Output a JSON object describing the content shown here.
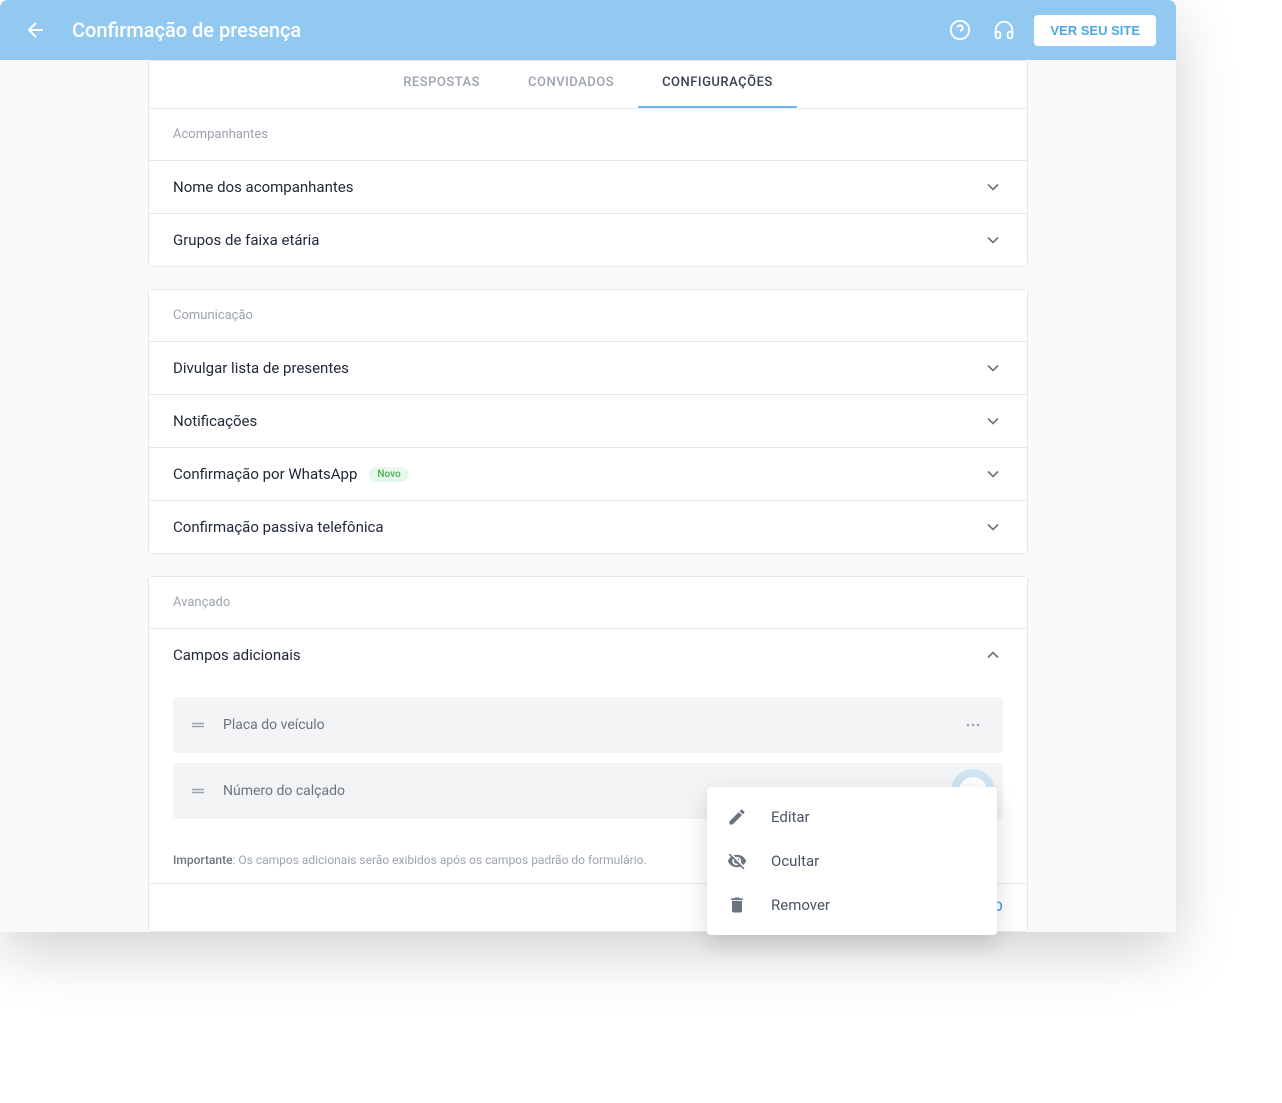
{
  "header": {
    "title": "Confirmação de presença",
    "view_site": "VER SEU SITE"
  },
  "tabs": {
    "respostas": "RESPOSTAS",
    "convidados": "CONVIDADOS",
    "configuracoes": "CONFIGURAÇÕES"
  },
  "sections": {
    "acompanhantes": {
      "title": "Acompanhantes",
      "rows": {
        "nome": "Nome dos acompanhantes",
        "grupos": "Grupos de faixa etária"
      }
    },
    "comunicacao": {
      "title": "Comunicação",
      "rows": {
        "divulgar": "Divulgar lista de presentes",
        "notificacoes": "Notificações",
        "whatsapp": "Confirmação por WhatsApp",
        "whatsapp_badge": "Novo",
        "telefonica": "Confirmação passiva telefônica"
      }
    },
    "avancado": {
      "title": "Avançado",
      "rows": {
        "campos": "Campos adicionais"
      },
      "fields": {
        "placa": "Placa do veículo",
        "calcado": "Número do calçado"
      },
      "note_bold": "Importante",
      "note_text": ": Os campos adicionais serão exibidos após os campos padrão do formulário.",
      "add_field": "IPO"
    }
  },
  "menu": {
    "editar": "Editar",
    "ocultar": "Ocultar",
    "remover": "Remover"
  }
}
